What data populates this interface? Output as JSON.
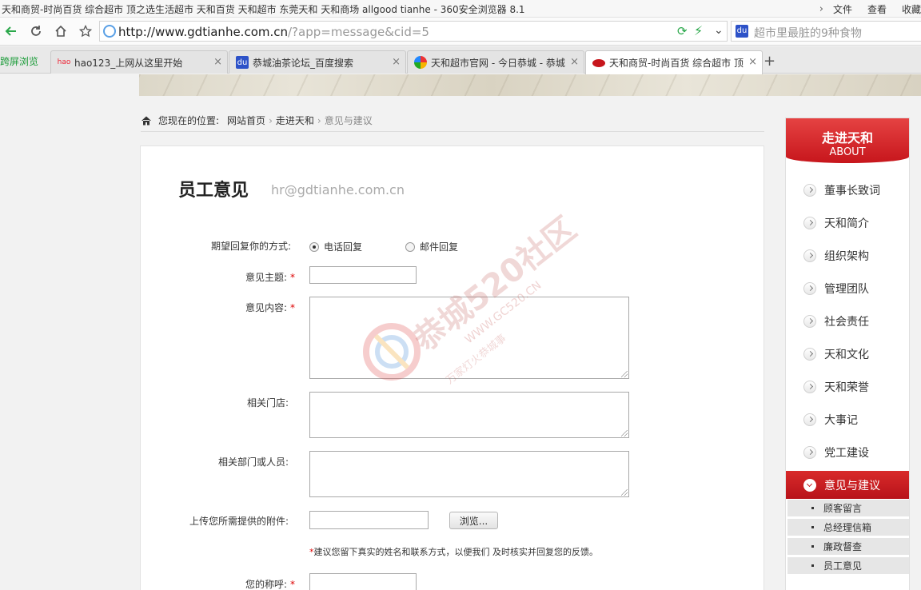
{
  "window": {
    "title": "天和商贸-时尚百货 综合超市 顶之选生活超市 天和百货 天和超市 东莞天和 天和商场 allgood tianhe - 360安全浏览器 8.1",
    "menu": [
      "文件",
      "查看",
      "收藏"
    ]
  },
  "navbar": {
    "url_host": "http://www.gdtianhe.com.cn",
    "url_path": "/?app=message&cid=5",
    "search_text": "超市里最脏的9种食物"
  },
  "tabs": {
    "side_label": "跨屏浏览",
    "items": [
      {
        "label": "hao123_上网从这里开始"
      },
      {
        "label": "恭城油茶论坛_百度搜索"
      },
      {
        "label": "天和超市官网 - 今日恭城 - 恭城"
      },
      {
        "label": "天和商贸-时尚百货 综合超市 顶"
      }
    ]
  },
  "breadcrumb": {
    "prefix": "您现在的位置:",
    "items": [
      "网站首页",
      "走进天和",
      "意见与建议"
    ]
  },
  "content": {
    "title": "员工意见",
    "email": "hr@gdtianhe.com.cn"
  },
  "form": {
    "reply_label": "期望回复你的方式:",
    "reply_phone": "电话回复",
    "reply_email": "邮件回复",
    "subject_label": "意见主题:",
    "body_label": "意见内容:",
    "store_label": "相关门店:",
    "dept_label": "相关部门或人员:",
    "attach_label": "上传您所需提供的附件:",
    "browse_label": "浏览...",
    "hint": "建议您留下真实的姓名和联系方式，以便我们 及时核实并回复您的反馈。",
    "name_label": "您的称呼:",
    "required_mark": "*"
  },
  "sidebar": {
    "title": "走进天和",
    "subtitle": "ABOUT",
    "items": [
      "董事长致词",
      "天和简介",
      "组织架构",
      "管理团队",
      "社会责任",
      "天和文化",
      "天和荣誉",
      "大事记",
      "党工建设",
      "意见与建议"
    ],
    "sub_items": [
      "顾客留言",
      "总经理信箱",
      "廉政督查",
      "员工意见"
    ]
  },
  "watermark": {
    "brand": "恭城520社区",
    "url": "WWW.GC520.CN",
    "slogan": "万家灯火恭城事"
  },
  "colors": {
    "accent_red": "#c7161c",
    "required_red": "#dd0000"
  }
}
